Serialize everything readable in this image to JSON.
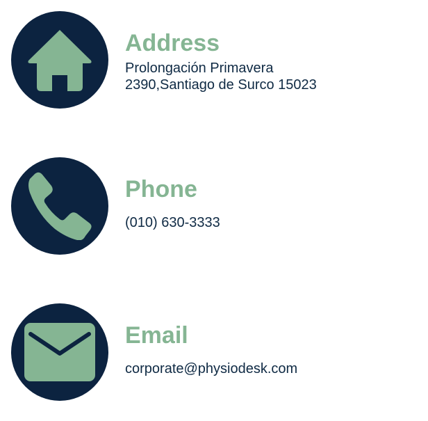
{
  "colors": {
    "circle": "#0c2340",
    "accent": "#85b593",
    "text": "#0f2a44"
  },
  "contacts": [
    {
      "icon": "house-icon",
      "title": "Address",
      "lines": [
        "Prolongación Primavera",
        "2390,Santiago de Surco 15023"
      ]
    },
    {
      "icon": "phone-icon",
      "title": "Phone",
      "lines": [
        "(010) 630-3333"
      ]
    },
    {
      "icon": "envelope-icon",
      "title": "Email",
      "lines": [
        "corporate@physiodesk.com"
      ]
    }
  ]
}
